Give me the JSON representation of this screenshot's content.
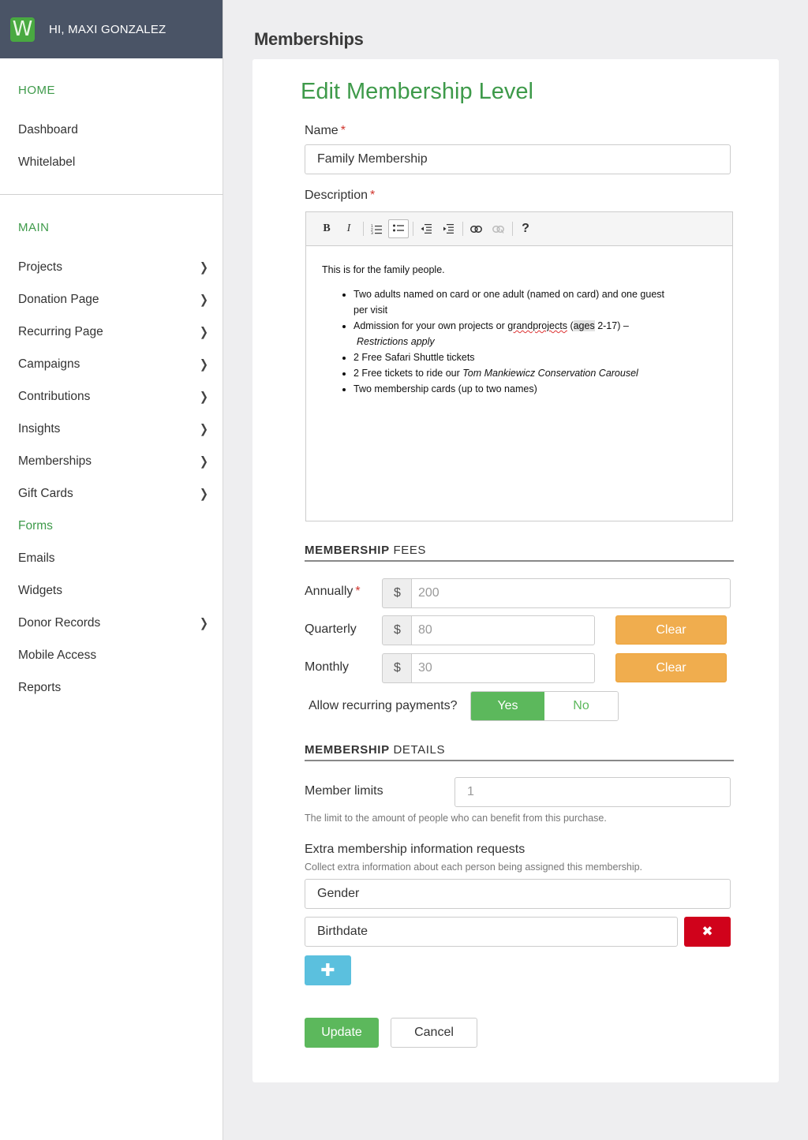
{
  "sidebar": {
    "greeting": "HI, MAXI GONZALEZ",
    "logo_letter": "W",
    "sections": [
      {
        "title": "HOME",
        "items": [
          {
            "label": "Dashboard"
          },
          {
            "label": "Whitelabel"
          }
        ]
      },
      {
        "title": "MAIN",
        "items": [
          {
            "label": "Projects",
            "has_submenu": true
          },
          {
            "label": "Donation Page",
            "has_submenu": true
          },
          {
            "label": "Recurring Page",
            "has_submenu": true
          },
          {
            "label": "Campaigns",
            "has_submenu": true
          },
          {
            "label": "Contributions",
            "has_submenu": true
          },
          {
            "label": "Insights",
            "has_submenu": true
          },
          {
            "label": "Memberships",
            "has_submenu": true
          },
          {
            "label": "Gift Cards",
            "has_submenu": true
          },
          {
            "label": "Forms",
            "active": true
          },
          {
            "label": "Emails"
          },
          {
            "label": "Widgets"
          },
          {
            "label": "Donor Records",
            "has_submenu": true
          },
          {
            "label": "Mobile Access"
          },
          {
            "label": "Reports"
          }
        ]
      }
    ]
  },
  "page": {
    "title": "Memberships"
  },
  "form": {
    "heading": "Edit Membership Level",
    "name_label": "Name",
    "name_value": "Family Membership",
    "description_label": "Description",
    "description": {
      "intro": "This is for the family people.",
      "bullets": {
        "b1": "Two adults named on card or one adult (named on card) and one guest per visit",
        "b2_pre": "Admission for your own projects or ",
        "b2_spell": "grandprojects",
        "b2_mid": " (",
        "b2_hl": "ages",
        "b2_post": " 2-17) –",
        "b2_italic": "Restrictions apply",
        "b3": "2 Free Safari Shuttle tickets",
        "b4_pre": "2 Free tickets to ride our ",
        "b4_italic": "Tom Mankiewicz Conservation Carousel",
        "b5": "Two membership cards (up to two names)"
      }
    },
    "toolbar_icons": [
      "bold-icon",
      "italic-icon",
      "ordered-list-icon",
      "unordered-list-icon",
      "outdent-icon",
      "indent-icon",
      "link-icon",
      "unlink-icon",
      "help-icon"
    ],
    "fees": {
      "section_bold": "MEMBERSHIP",
      "section_rest": " FEES",
      "currency": "$",
      "annually_label": "Annually",
      "annually_value": "200",
      "quarterly_label": "Quarterly",
      "quarterly_value": "80",
      "monthly_label": "Monthly",
      "monthly_value": "30",
      "clear_label": "Clear",
      "recurring_label": "Allow recurring payments?",
      "yes_label": "Yes",
      "no_label": "No",
      "recurring_selected": "Yes"
    },
    "details": {
      "section_bold": "MEMBERSHIP",
      "section_rest": " DETAILS",
      "limits_label": "Member limits",
      "limits_value": "1",
      "limits_help": "The limit to the amount of people who can benefit from this purchase.",
      "extra_label": "Extra membership information requests",
      "extra_help": "Collect extra information about each person being assigned this membership.",
      "extra_items": [
        "Gender",
        "Birthdate"
      ],
      "remove_glyph": "✖",
      "add_glyph": "✚"
    },
    "update_label": "Update",
    "cancel_label": "Cancel"
  },
  "colors": {
    "brand_green": "#3e9a4a",
    "header_bg": "#4a5466",
    "clear_orange": "#f0ad4e",
    "danger_red": "#d0021b",
    "info_blue": "#5bc0de",
    "success_green": "#5cb85c"
  }
}
